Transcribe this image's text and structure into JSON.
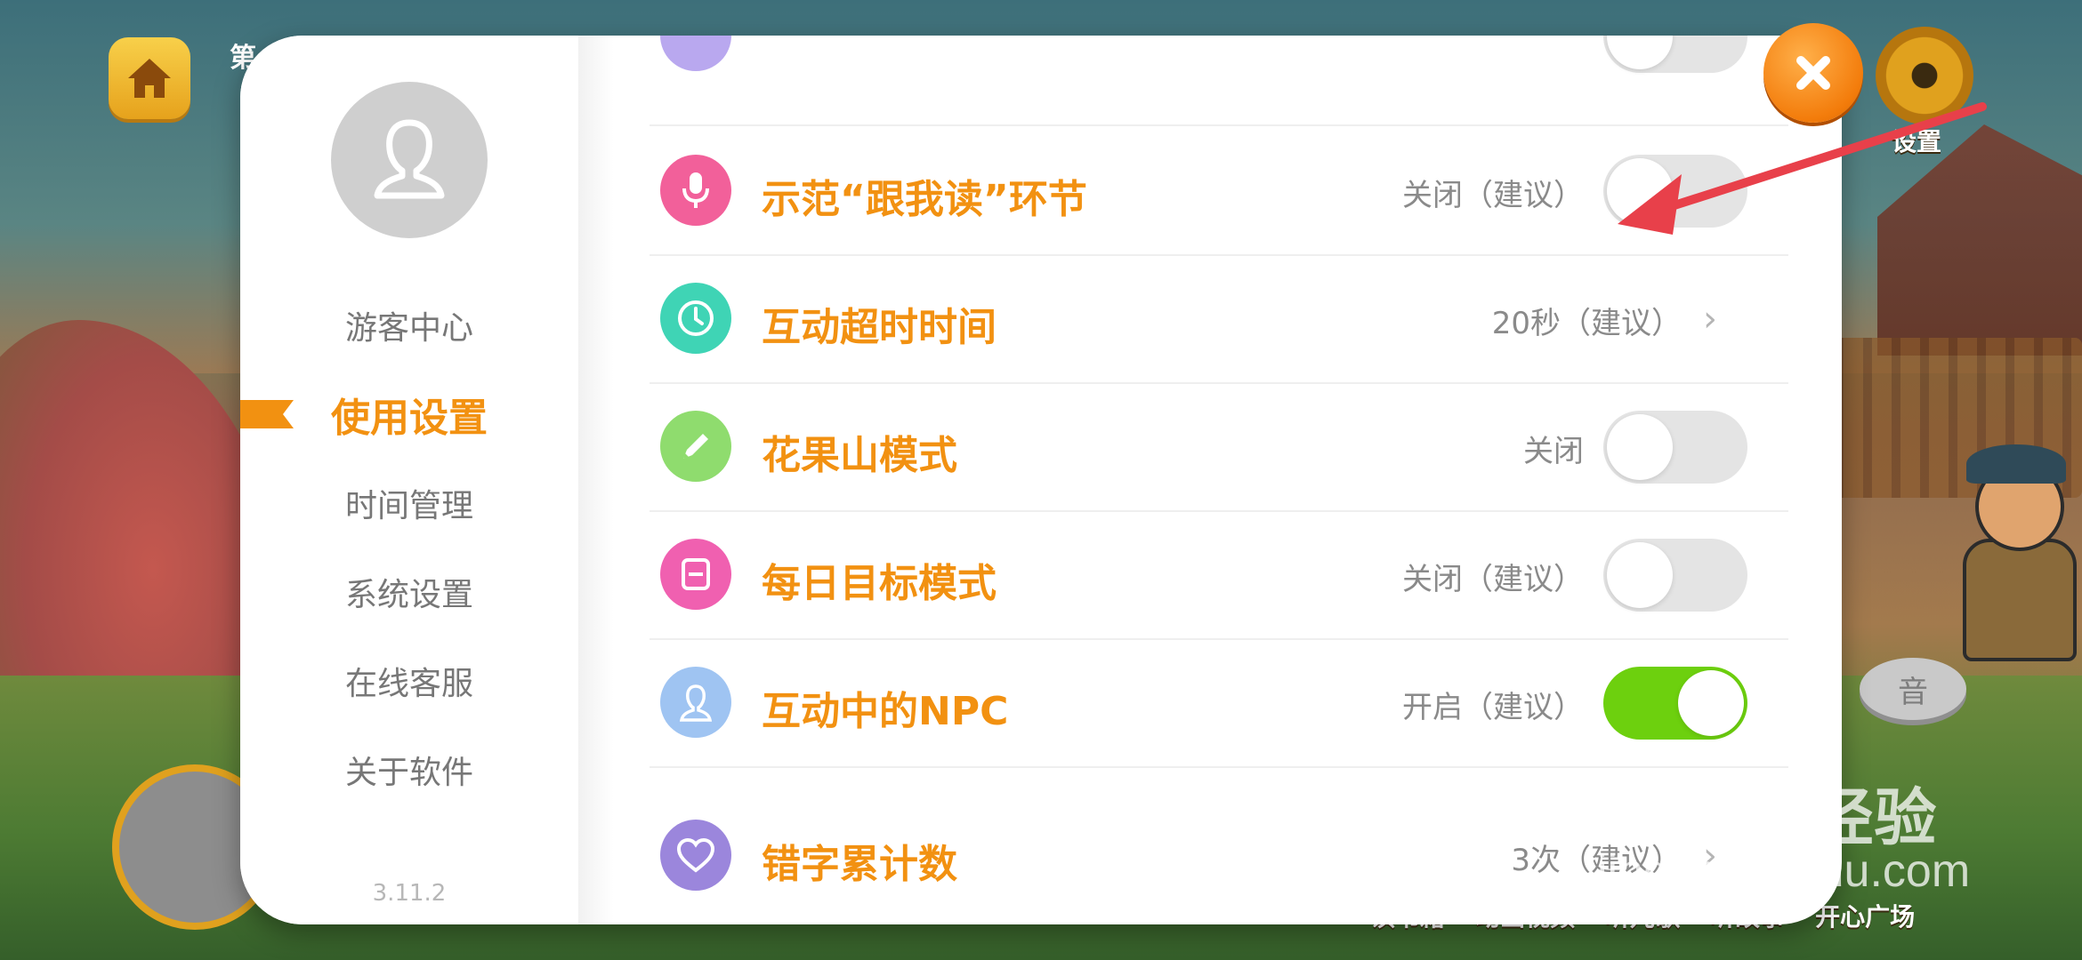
{
  "background": {
    "top_label": "第",
    "settings_label": "设置",
    "sound_label": "音",
    "bottom_nav": [
      "读书籍",
      "动画视频",
      "听儿歌",
      "听故事",
      "开心广场"
    ]
  },
  "sidebar": {
    "items": [
      {
        "label": "游客中心"
      },
      {
        "label": "使用设置"
      },
      {
        "label": "时间管理"
      },
      {
        "label": "系统设置"
      },
      {
        "label": "在线客服"
      },
      {
        "label": "关于软件"
      }
    ],
    "active_index": 1,
    "version": "3.11.2"
  },
  "settings": {
    "rows": [
      {
        "title": "示范“跟我读”环节",
        "value": "关闭（建议）",
        "control": "toggle",
        "on": false,
        "icon": "microphone-icon",
        "color": "#f2609a"
      },
      {
        "title": "互动超时时间",
        "value": "20秒（建议）",
        "control": "chevron",
        "icon": "clock-icon",
        "color": "#3fd4b5"
      },
      {
        "title": "花果山模式",
        "value": "关闭",
        "control": "toggle",
        "on": false,
        "icon": "pencil-icon",
        "color": "#8fdc6e"
      },
      {
        "title": "每日目标模式",
        "value": "关闭（建议）",
        "control": "toggle",
        "on": false,
        "icon": "calendar-icon",
        "color": "#f060b0"
      },
      {
        "title": "互动中的NPC",
        "value": "开启（建议）",
        "control": "toggle",
        "on": true,
        "icon": "person-icon",
        "color": "#9fc4f2"
      },
      {
        "title": "错字累计数",
        "value": "3次（建议）",
        "control": "chevron",
        "icon": "heart-icon",
        "color": "#9b86dc"
      }
    ]
  },
  "watermark": {
    "main": "Bai du 经验",
    "sub": "jingyan.baidu.com"
  },
  "colors": {
    "accent": "#f29111",
    "toggle_on": "#6dd00e",
    "toggle_off": "#e4e4e4",
    "annotation_arrow": "#e8404a"
  }
}
